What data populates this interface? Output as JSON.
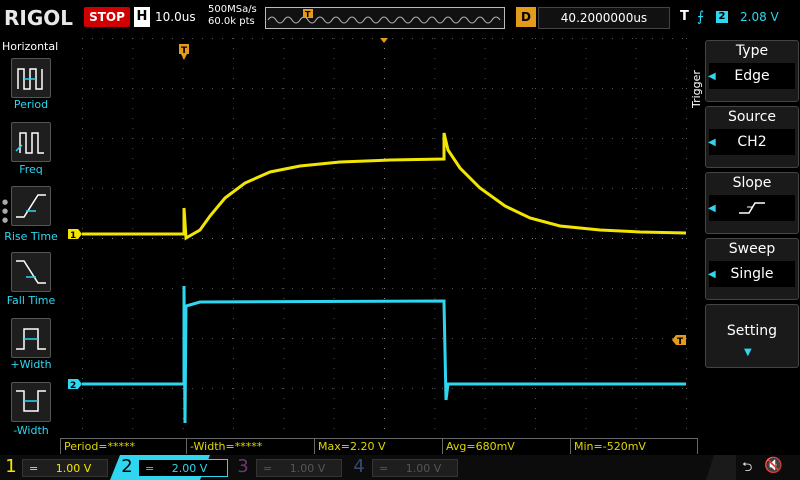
{
  "header": {
    "brand": "RIGOL",
    "run_state": "STOP",
    "timebase_label": "H",
    "timebase_value": "10.0us",
    "sample_rate": "500MSa/s",
    "memory_depth": "60.0k pts",
    "delay_label": "D",
    "delay_value": "40.2000000us",
    "trigger_label": "T",
    "trigger_channel": "2",
    "trigger_level": "2.08 V"
  },
  "left_menu": {
    "title": "Horizontal",
    "items": [
      {
        "label": "Period",
        "icon": "period-icon"
      },
      {
        "label": "Freq",
        "icon": "frequency-icon"
      },
      {
        "label": "Rise Time",
        "icon": "rise-time-icon"
      },
      {
        "label": "Fall Time",
        "icon": "fall-time-icon"
      },
      {
        "label": "+Width",
        "icon": "positive-width-icon"
      },
      {
        "label": "-Width",
        "icon": "negative-width-icon"
      }
    ]
  },
  "right_menu": {
    "title": "Trigger",
    "type": {
      "label": "Type",
      "value": "Edge"
    },
    "source": {
      "label": "Source",
      "value": "CH2"
    },
    "slope": {
      "label": "Slope",
      "icon": "rising-edge-icon"
    },
    "sweep": {
      "label": "Sweep",
      "value": "Single"
    },
    "setting": {
      "label": "Setting"
    }
  },
  "channel_markers": {
    "ch1": "1",
    "ch2": "2",
    "trig_pos": "T"
  },
  "measurements": {
    "period": "Period=*****",
    "neg_width": "-Width=*****",
    "max": "Max=2.20 V",
    "avg": "Avg=680mV",
    "min": "Min=-520mV"
  },
  "channels": [
    {
      "num": "1",
      "scale": "1.00 V",
      "color": "#f2e600"
    },
    {
      "num": "2",
      "scale": "2.00 V",
      "color": "#2ed6ef"
    },
    {
      "num": "3",
      "scale": "1.00 V",
      "color": "#6a3a6a"
    },
    {
      "num": "4",
      "scale": "1.00 V",
      "color": "#3a4a6a"
    }
  ],
  "colors": {
    "ch1": "#f2e600",
    "ch2": "#2ed6ef",
    "accent": "#e49a1a",
    "stop": "#d00000"
  }
}
